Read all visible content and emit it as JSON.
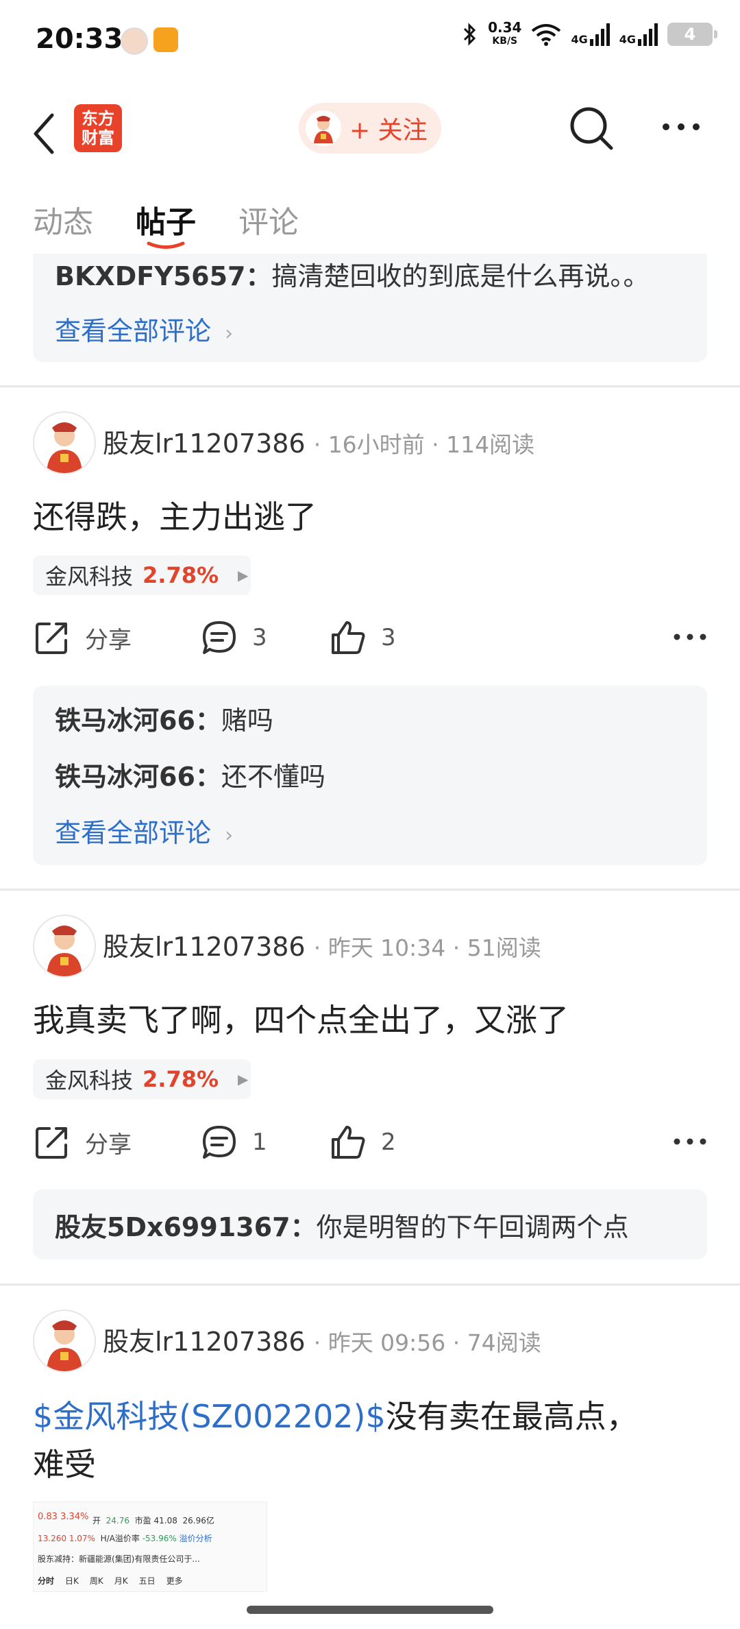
{
  "status": {
    "time": "20:33",
    "net_speed_value": "0.34",
    "net_speed_unit": "KB/S",
    "network_1": "4G",
    "network_2": "4G",
    "battery": "4"
  },
  "header": {
    "logo_line1": "东方",
    "logo_line2": "财富",
    "follow_label": "+ 关注"
  },
  "tabs": [
    {
      "label": "动态",
      "active": false
    },
    {
      "label": "帖子",
      "active": true
    },
    {
      "label": "评论",
      "active": false
    }
  ],
  "top_comment": {
    "user": "BKXDFY5657：",
    "text": "搞清楚回收的到底是什么再说。。",
    "see_all": "查看全部评论"
  },
  "posts": [
    {
      "author": "股友lr11207386",
      "time": "16小时前",
      "reads": "114阅读",
      "text": "还得跌，主力出逃了",
      "stock": {
        "name": "金风科技",
        "change": "2.78%"
      },
      "share_label": "分享",
      "comments": "3",
      "likes": "3",
      "replies": [
        {
          "user": "铁马冰河66：",
          "text": "赌吗"
        },
        {
          "user": "铁马冰河66：",
          "text": "还不懂吗"
        }
      ],
      "see_all": "查看全部评论"
    },
    {
      "author": "股友lr11207386",
      "time": "昨天 10:34",
      "reads": "51阅读",
      "text": "我真卖飞了啊，四个点全出了，又涨了",
      "stock": {
        "name": "金风科技",
        "change": "2.78%"
      },
      "share_label": "分享",
      "comments": "1",
      "likes": "2",
      "replies": [
        {
          "user": "股友5Dx6991367：",
          "text": "你是明智的下午回调两个点"
        }
      ]
    },
    {
      "author": "股友lr11207386",
      "time": "昨天 09:56",
      "reads": "74阅读",
      "text_link": "$金风科技(SZ002202)$",
      "text_rest": "没有卖在最高点，",
      "text_line2": "难受",
      "thumbnail": {
        "row1_a": "0.83",
        "row1_b": "3.34%",
        "open_label": "开",
        "open_value": "24.76",
        "pe_label": "市盈",
        "pe_value": "41.08",
        "amount": "26.96亿",
        "row3_a": "13.260",
        "row3_b": "1.07%",
        "premium_label": "H/A溢价率",
        "premium_value": "-53.96%",
        "premium_link": "溢价分析",
        "notice": "股东减持：新疆能源(集团)有限责任公司于...",
        "tabs": [
          "分时",
          "日K",
          "周K",
          "月K",
          "五日",
          "更多"
        ]
      }
    }
  ]
}
